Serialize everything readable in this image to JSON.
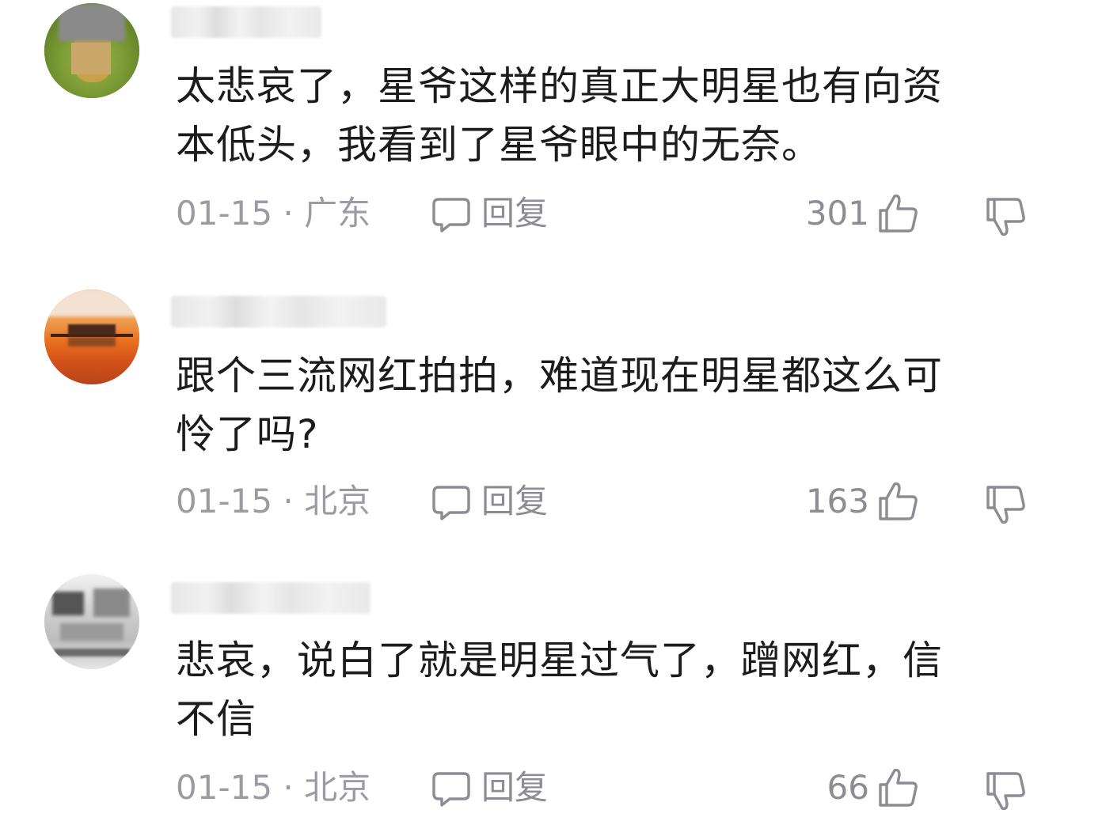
{
  "comments": [
    {
      "text": "太悲哀了，星爷这样的真正大明星也有向资\n本低头，我看到了星爷眼中的无奈。",
      "date_location": "01-15 · 广东",
      "reply_label": "回复",
      "likes": "301"
    },
    {
      "text": "跟个三流网红拍拍，难道现在明星都这么可\n怜了吗?",
      "date_location": "01-15 · 北京",
      "reply_label": "回复",
      "likes": "163"
    },
    {
      "text": "悲哀，说白了就是明星过气了，蹭网红，信\n不信",
      "date_location": "01-15 · 北京",
      "reply_label": "回复",
      "likes": "66"
    }
  ],
  "colors": {
    "text": "#1c1c1c",
    "meta": "#9b9ba3",
    "icon": "#8c8c95",
    "background": "#ffffff"
  }
}
